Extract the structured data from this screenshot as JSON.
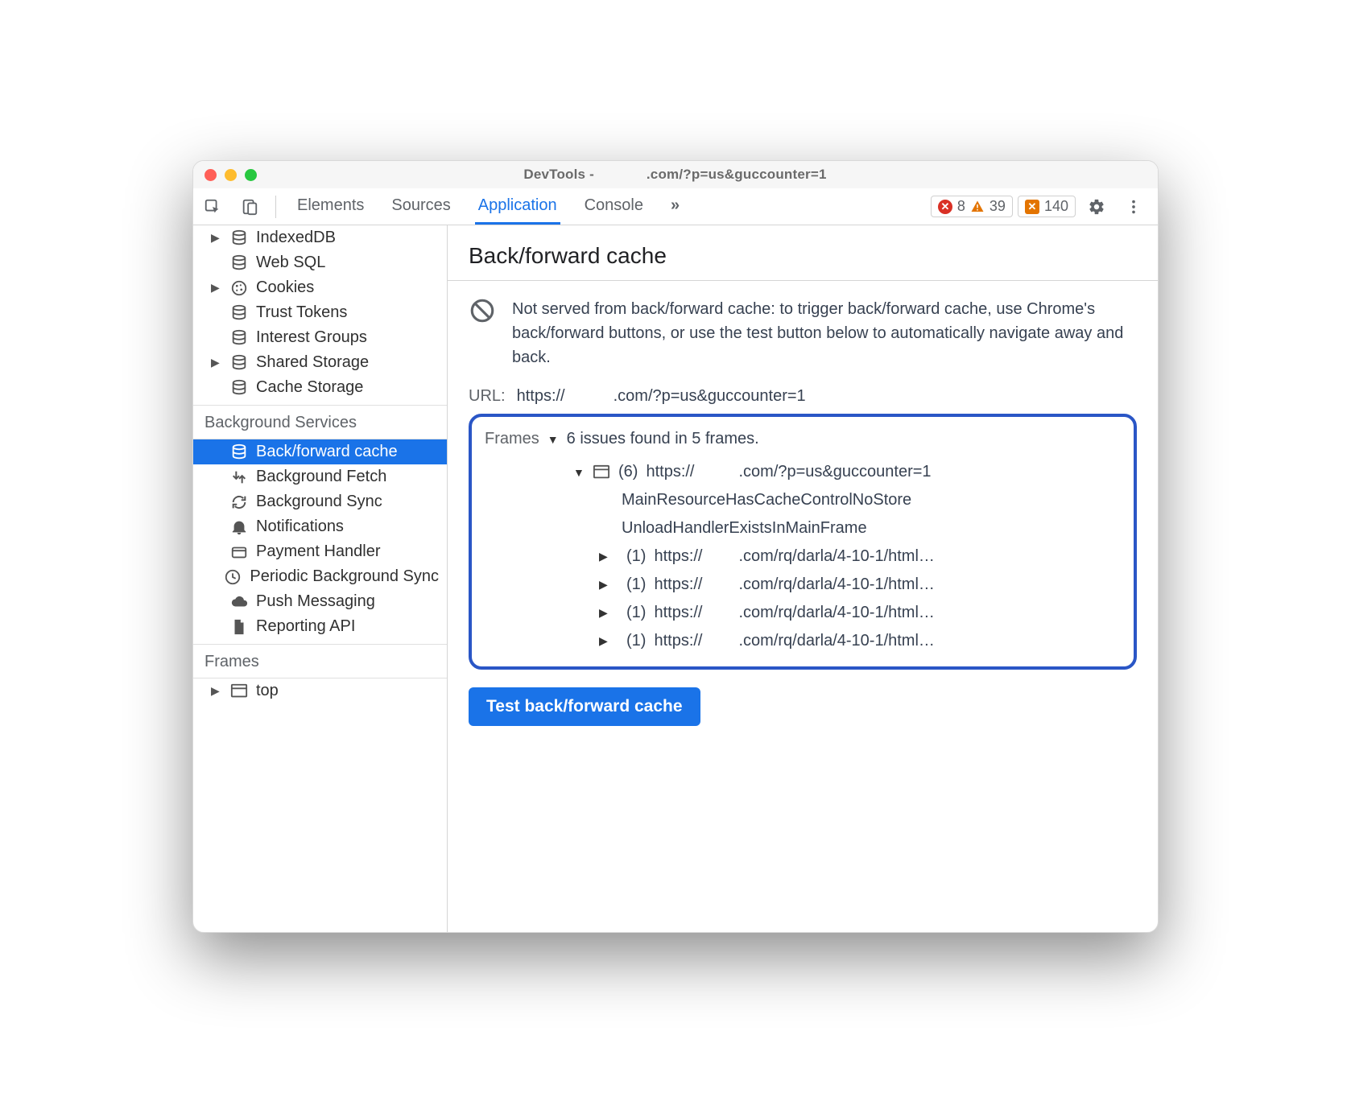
{
  "window": {
    "title_prefix": "DevTools -",
    "title_suffix": ".com/?p=us&guccounter=1"
  },
  "toolbar": {
    "tabs": [
      "Elements",
      "Sources",
      "Application",
      "Console"
    ],
    "active_tab": "Application",
    "more_glyph": "»",
    "errors": {
      "count": "8"
    },
    "warnings": {
      "count": "39"
    },
    "issues": {
      "count": "140"
    }
  },
  "sidebar": {
    "storage": [
      {
        "label": "IndexedDB",
        "icon": "db",
        "expandable": true
      },
      {
        "label": "Web SQL",
        "icon": "db"
      },
      {
        "label": "Cookies",
        "icon": "cookie",
        "expandable": true
      },
      {
        "label": "Trust Tokens",
        "icon": "db"
      },
      {
        "label": "Interest Groups",
        "icon": "db"
      },
      {
        "label": "Shared Storage",
        "icon": "db",
        "expandable": true
      },
      {
        "label": "Cache Storage",
        "icon": "db"
      }
    ],
    "bg_title": "Background Services",
    "bg": [
      {
        "label": "Back/forward cache",
        "icon": "db",
        "selected": true
      },
      {
        "label": "Background Fetch",
        "icon": "fetch"
      },
      {
        "label": "Background Sync",
        "icon": "sync"
      },
      {
        "label": "Notifications",
        "icon": "bell"
      },
      {
        "label": "Payment Handler",
        "icon": "card"
      },
      {
        "label": "Periodic Background Sync",
        "icon": "clock"
      },
      {
        "label": "Push Messaging",
        "icon": "cloud"
      },
      {
        "label": "Reporting API",
        "icon": "doc"
      }
    ],
    "frames_title": "Frames",
    "frames": [
      {
        "label": "top",
        "icon": "frame",
        "expandable": true
      }
    ]
  },
  "main": {
    "heading": "Back/forward cache",
    "info": "Not served from back/forward cache: to trigger back/forward cache, use Chrome's back/forward buttons, or use the test button below to automatically navigate away and back.",
    "url_label": "URL:",
    "url_prefix": "https://",
    "url_suffix": ".com/?p=us&guccounter=1",
    "frames_label": "Frames",
    "frames_summary": "6 issues found in 5 frames.",
    "root": {
      "count": "(6)",
      "url_prefix": "https://",
      "url_suffix": ".com/?p=us&guccounter=1",
      "reasons": [
        "MainResourceHasCacheControlNoStore",
        "UnloadHandlerExistsInMainFrame"
      ],
      "children": [
        {
          "count": "(1)",
          "url_prefix": "https://",
          "url_suffix": ".com/rq/darla/4-10-1/html…"
        },
        {
          "count": "(1)",
          "url_prefix": "https://",
          "url_suffix": ".com/rq/darla/4-10-1/html…"
        },
        {
          "count": "(1)",
          "url_prefix": "https://",
          "url_suffix": ".com/rq/darla/4-10-1/html…"
        },
        {
          "count": "(1)",
          "url_prefix": "https://",
          "url_suffix": ".com/rq/darla/4-10-1/html…"
        }
      ]
    },
    "test_button": "Test back/forward cache"
  }
}
